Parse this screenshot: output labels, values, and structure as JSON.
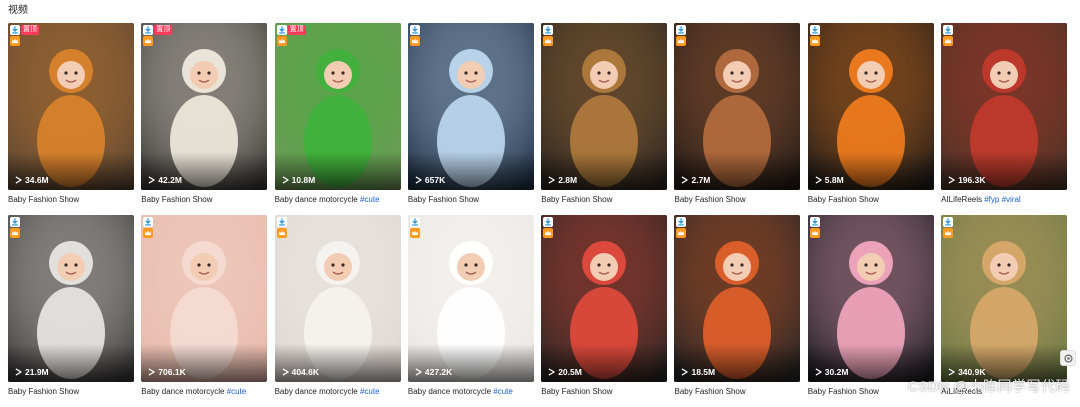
{
  "section": {
    "title": "视频"
  },
  "cards": [
    {
      "views": "34.6M",
      "caption": "Baby Fashion Show",
      "tags": "",
      "tag": "置顶",
      "crown": true,
      "download": true,
      "bg": "#5b4634",
      "accent": "#d9822b",
      "theme": "tiger"
    },
    {
      "views": "42.2M",
      "caption": "Baby Fashion Show",
      "tags": "",
      "tag": "置顶",
      "crown": true,
      "download": true,
      "bg": "#3d3b38",
      "accent": "#efe9dc",
      "theme": "sheep"
    },
    {
      "views": "10.8M",
      "caption": "Baby dance motorcycle",
      "tags": "#cute",
      "tag": "置顶",
      "crown": true,
      "download": true,
      "bg": "#6e9a57",
      "accent": "#3fb13b",
      "theme": "frog"
    },
    {
      "views": "657K",
      "caption": "Baby Fashion Show",
      "tags": "",
      "tag": "",
      "crown": true,
      "download": true,
      "bg": "#22324a",
      "accent": "#bcd7ee",
      "theme": "cat"
    },
    {
      "views": "2.8M",
      "caption": "Baby Fashion Show",
      "tags": "",
      "tag": "",
      "crown": true,
      "download": true,
      "bg": "#2b2420",
      "accent": "#b07a3c",
      "theme": "lion"
    },
    {
      "views": "2.7M",
      "caption": "Baby Fashion Show",
      "tags": "",
      "tag": "",
      "crown": true,
      "download": true,
      "bg": "#231a16",
      "accent": "#b46b3e",
      "theme": "pumpkin"
    },
    {
      "views": "5.8M",
      "caption": "Baby Fashion Show",
      "tags": "",
      "tag": "",
      "crown": true,
      "download": true,
      "bg": "#1f1c1a",
      "accent": "#f07c1d",
      "theme": "carrot"
    },
    {
      "views": "196.3K",
      "caption": "AILifeReels",
      "tags": "#fyp #viral",
      "tag": "",
      "crown": true,
      "download": true,
      "bg": "#4a3226",
      "accent": "#c0392b",
      "theme": "kitten"
    },
    {
      "views": "21.9M",
      "caption": "Baby Fashion Show",
      "tags": "",
      "tag": "",
      "crown": true,
      "download": true,
      "bg": "#3c3a3a",
      "accent": "#e8e6e3",
      "theme": "whitetiger"
    },
    {
      "views": "706.1K",
      "caption": "Baby dance motorcycle",
      "tags": "#cute",
      "tag": "",
      "crown": true,
      "download": true,
      "bg": "#e7b8a8",
      "accent": "#f4dbd2",
      "theme": "bunny"
    },
    {
      "views": "404.6K",
      "caption": "Baby dance motorcycle",
      "tags": "#cute",
      "tag": "",
      "crown": true,
      "download": true,
      "bg": "#ddd6d0",
      "accent": "#f6f3ef",
      "theme": "bunny"
    },
    {
      "views": "427.2K",
      "caption": "Baby dance motorcycle",
      "tags": "#cute",
      "tag": "",
      "crown": true,
      "download": true,
      "bg": "#e9e5e1",
      "accent": "#ffffff",
      "theme": "bunny"
    },
    {
      "views": "20.5M",
      "caption": "Baby Fashion Show",
      "tags": "",
      "tag": "",
      "crown": true,
      "download": true,
      "bg": "#2a2522",
      "accent": "#e14a3c",
      "theme": "flowers"
    },
    {
      "views": "18.5M",
      "caption": "Baby Fashion Show",
      "tags": "",
      "tag": "",
      "crown": true,
      "download": true,
      "bg": "#242424",
      "accent": "#e0602a",
      "theme": "leaves"
    },
    {
      "views": "30.2M",
      "caption": "Baby Fashion Show",
      "tags": "",
      "tag": "",
      "crown": true,
      "download": true,
      "bg": "#1e1e24",
      "accent": "#f2a6bd",
      "theme": "petals"
    },
    {
      "views": "340.9K",
      "caption": "AILifeReels",
      "tags": "",
      "tag": "",
      "crown": true,
      "download": true,
      "bg": "#6d7a45",
      "accent": "#d8a86a",
      "theme": "frogcat"
    }
  ],
  "watermark": "CSDN @小陈同学写代码",
  "icons": {
    "play": "play-icon",
    "download": "download-icon",
    "crown": "crown-icon",
    "side": "settings-icon"
  }
}
